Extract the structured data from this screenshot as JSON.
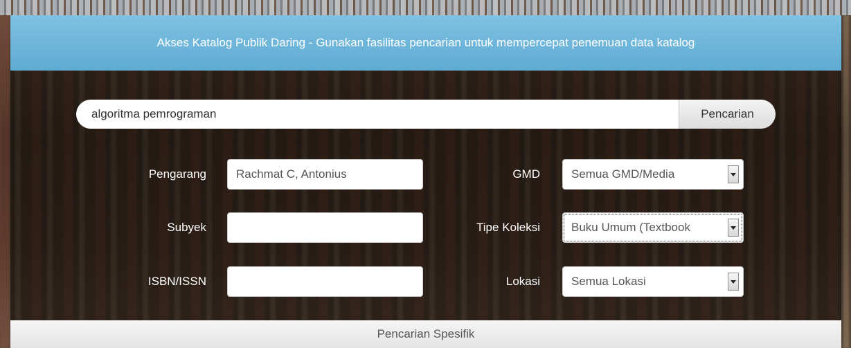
{
  "header": {
    "title": "Akses Katalog Publik Daring - Gunakan fasilitas pencarian untuk mempercepat penemuan data katalog"
  },
  "search": {
    "value": "algoritma pemrograman",
    "button_label": "Pencarian"
  },
  "fields": {
    "author": {
      "label": "Pengarang",
      "value": "Rachmat C, Antonius"
    },
    "subject": {
      "label": "Subyek",
      "value": ""
    },
    "isbn": {
      "label": "ISBN/ISSN",
      "value": ""
    },
    "gmd": {
      "label": "GMD",
      "selected": "Semua GMD/Media"
    },
    "collection_type": {
      "label": "Tipe Koleksi",
      "selected": "Buku Umum (Textbook"
    },
    "location": {
      "label": "Lokasi",
      "selected": "Semua Lokasi"
    }
  },
  "footer": {
    "label": "Pencarian Spesifik"
  }
}
